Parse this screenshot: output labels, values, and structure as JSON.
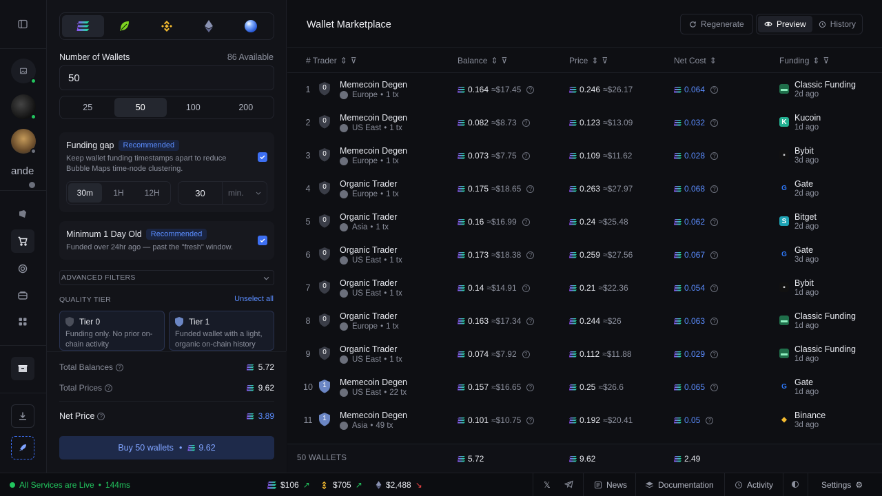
{
  "panel": {
    "chains": [
      "solana-icon",
      "leaf-icon",
      "bnb-icon",
      "ethereum-icon",
      "blue-sphere-icon"
    ],
    "wallets_label": "Number of Wallets",
    "available": "86 Available",
    "wallets_value": "50",
    "presets": [
      "25",
      "50",
      "100",
      "200"
    ],
    "selected_preset": "50",
    "funding_gap": {
      "title": "Funding gap",
      "badge": "Recommended",
      "desc_line1": "Keep wallet funding timestamps apart to reduce",
      "desc_line2": "Bubble Maps time-node clustering.",
      "intervals": [
        "30m",
        "1H",
        "12H"
      ],
      "custom_value": "30",
      "unit": "min."
    },
    "min_age": {
      "title": "Minimum 1 Day Old",
      "badge": "Recommended",
      "desc": "Funded over 24hr ago — past the \"fresh\" window."
    },
    "advanced": "ADVANCED FILTERS",
    "quality_tier": "QUALITY TIER",
    "unselect_all": "Unselect all",
    "tiers": [
      {
        "name": "Tier 0",
        "badge": "0",
        "line1": "Funding only. No prior on-",
        "line2": "chain activity"
      },
      {
        "name": "Tier 1",
        "badge": "1",
        "line1": "Funded wallet with a light,",
        "line2": "organic on-chain history"
      }
    ],
    "totals": {
      "balances_label": "Total Balances",
      "balances_value": "5.72",
      "prices_label": "Total Prices",
      "prices_value": "9.62",
      "net_label": "Net Price",
      "net_value": "3.89"
    },
    "buy_label": "Buy 50 wallets",
    "buy_price": "9.62"
  },
  "main": {
    "title": "Wallet Marketplace",
    "regenerate": "Regenerate",
    "preview": "Preview",
    "history": "History",
    "columns": {
      "trader": "# Trader",
      "balance": "Balance",
      "price": "Price",
      "net_cost": "Net Cost",
      "funding": "Funding"
    },
    "rows": [
      {
        "n": "1",
        "tier": "0",
        "name": "Memecoin Degen",
        "region": "Europe",
        "tx": "1 tx",
        "bal": "0.164",
        "bal_usd": "≈$17.45",
        "price": "0.246",
        "price_usd": "≈$26.17",
        "net": "0.064",
        "fund": "Classic Funding",
        "fund_icon": "classic-funding-icon",
        "ago": "2d ago"
      },
      {
        "n": "2",
        "tier": "0",
        "name": "Memecoin Degen",
        "region": "US East",
        "tx": "1 tx",
        "bal": "0.082",
        "bal_usd": "≈$8.73",
        "price": "0.123",
        "price_usd": "≈$13.09",
        "net": "0.032",
        "fund": "Kucoin",
        "fund_icon": "kucoin-icon",
        "ago": "1d ago"
      },
      {
        "n": "3",
        "tier": "0",
        "name": "Memecoin Degen",
        "region": "Europe",
        "tx": "1 tx",
        "bal": "0.073",
        "bal_usd": "≈$7.75",
        "price": "0.109",
        "price_usd": "≈$11.62",
        "net": "0.028",
        "fund": "Bybit",
        "fund_icon": "bybit-icon",
        "ago": "3d ago"
      },
      {
        "n": "4",
        "tier": "0",
        "name": "Organic Trader",
        "region": "Europe",
        "tx": "1 tx",
        "bal": "0.175",
        "bal_usd": "≈$18.65",
        "price": "0.263",
        "price_usd": "≈$27.97",
        "net": "0.068",
        "fund": "Gate",
        "fund_icon": "gate-icon",
        "ago": "2d ago"
      },
      {
        "n": "5",
        "tier": "0",
        "name": "Organic Trader",
        "region": "Asia",
        "tx": "1 tx",
        "bal": "0.16",
        "bal_usd": "≈$16.99",
        "price": "0.24",
        "price_usd": "≈$25.48",
        "net": "0.062",
        "fund": "Bitget",
        "fund_icon": "bitget-icon",
        "ago": "2d ago"
      },
      {
        "n": "6",
        "tier": "0",
        "name": "Organic Trader",
        "region": "US East",
        "tx": "1 tx",
        "bal": "0.173",
        "bal_usd": "≈$18.38",
        "price": "0.259",
        "price_usd": "≈$27.56",
        "net": "0.067",
        "fund": "Gate",
        "fund_icon": "gate-icon",
        "ago": "3d ago"
      },
      {
        "n": "7",
        "tier": "0",
        "name": "Organic Trader",
        "region": "US East",
        "tx": "1 tx",
        "bal": "0.14",
        "bal_usd": "≈$14.91",
        "price": "0.21",
        "price_usd": "≈$22.36",
        "net": "0.054",
        "fund": "Bybit",
        "fund_icon": "bybit-icon",
        "ago": "1d ago"
      },
      {
        "n": "8",
        "tier": "0",
        "name": "Organic Trader",
        "region": "Europe",
        "tx": "1 tx",
        "bal": "0.163",
        "bal_usd": "≈$17.34",
        "price": "0.244",
        "price_usd": "≈$26",
        "net": "0.063",
        "fund": "Classic Funding",
        "fund_icon": "classic-funding-icon",
        "ago": "1d ago"
      },
      {
        "n": "9",
        "tier": "0",
        "name": "Organic Trader",
        "region": "US East",
        "tx": "1 tx",
        "bal": "0.074",
        "bal_usd": "≈$7.92",
        "price": "0.112",
        "price_usd": "≈$11.88",
        "net": "0.029",
        "fund": "Classic Funding",
        "fund_icon": "classic-funding-icon",
        "ago": "1d ago"
      },
      {
        "n": "10",
        "tier": "1",
        "name": "Memecoin Degen",
        "region": "US East",
        "tx": "22 tx",
        "bal": "0.157",
        "bal_usd": "≈$16.65",
        "price": "0.25",
        "price_usd": "≈$26.6",
        "net": "0.065",
        "fund": "Gate",
        "fund_icon": "gate-icon",
        "ago": "1d ago"
      },
      {
        "n": "11",
        "tier": "1",
        "name": "Memecoin Degen",
        "region": "Asia",
        "tx": "49 tx",
        "bal": "0.101",
        "bal_usd": "≈$10.75",
        "price": "0.192",
        "price_usd": "≈$20.41",
        "net": "0.05",
        "fund": "Binance",
        "fund_icon": "binance-icon",
        "ago": "3d ago"
      }
    ],
    "footer": {
      "count": "50 WALLETS",
      "balance": "5.72",
      "price": "9.62",
      "net": "2.49"
    }
  },
  "rail": {
    "user_initials": "ande"
  },
  "status": {
    "live": "All Services are Live",
    "latency": "144ms",
    "sol": "$106",
    "bnb": "$705",
    "eth": "$2,488",
    "news": "News",
    "docs": "Documentation",
    "activity": "Activity",
    "settings": "Settings"
  },
  "colors": {
    "accent": "#3d6ff2",
    "link": "#5b8dff",
    "live": "#22c55e",
    "up": "#22c55e",
    "down": "#ef4444"
  }
}
